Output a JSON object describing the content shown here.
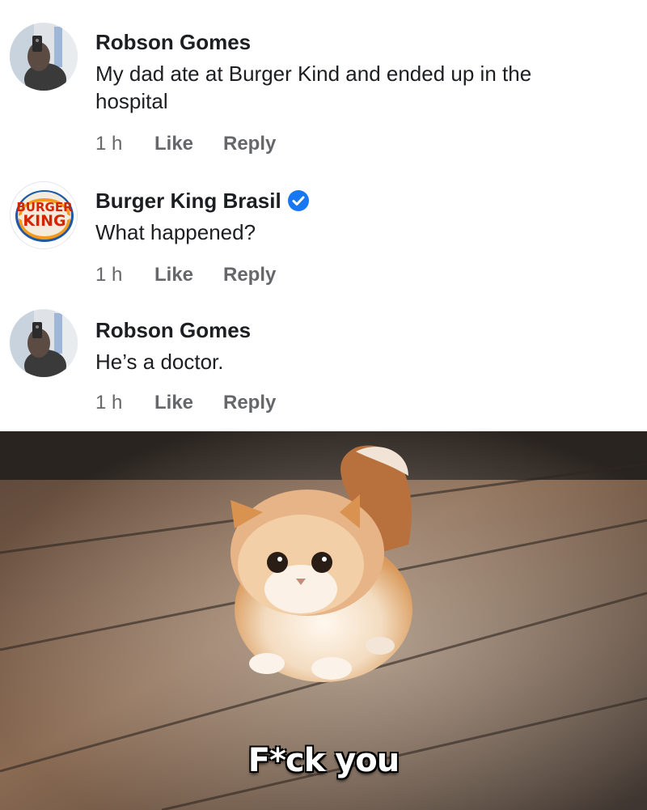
{
  "comments": [
    {
      "author": "Robson Gomes",
      "text": "My dad ate at Burger Kind and ended up in the hospital",
      "time": "1 h",
      "like_label": "Like",
      "reply_label": "Reply",
      "avatar_icon": "profile-photo-avatar"
    },
    {
      "author": "Burger King Brasil",
      "verified": true,
      "text": "What happened?",
      "time": "1 h",
      "like_label": "Like",
      "reply_label": "Reply",
      "avatar_icon": "burger-king-logo",
      "logo_line1": "BURGER",
      "logo_line2": "KING"
    },
    {
      "author": "Robson Gomes",
      "text": "He’s a doctor.",
      "time": "1 h",
      "like_label": "Like",
      "reply_label": "Reply",
      "avatar_icon": "profile-photo-avatar"
    }
  ],
  "meme": {
    "caption": "F*ck you",
    "image": "kitten-on-wooden-floor"
  },
  "colors": {
    "verified_badge": "#1877f2",
    "action_text": "#65676b",
    "primary_text": "#1c1e21"
  }
}
